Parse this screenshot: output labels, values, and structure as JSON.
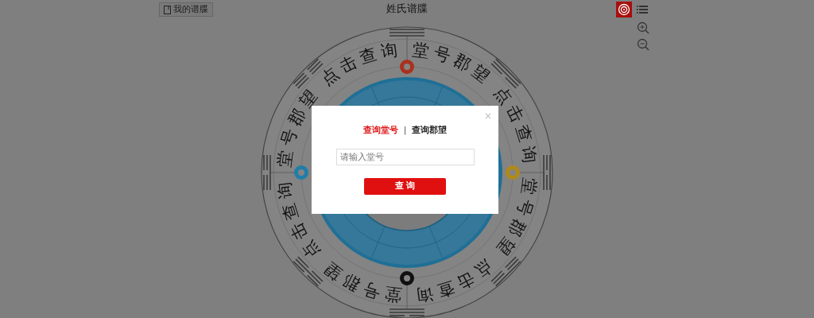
{
  "header": {
    "my_button": "我的谱牒",
    "title": "姓氏谱牒"
  },
  "toolbar": [
    {
      "kind": "target",
      "selected": true
    },
    {
      "kind": "list",
      "selected": false
    }
  ],
  "zoom": [
    {
      "kind": "zoom_in"
    },
    {
      "kind": "zoom_out"
    }
  ],
  "wheel": {
    "ring_labels": [
      "点击查询",
      "堂号郡望",
      "堂号郡望",
      "点击查询",
      "点击查询",
      "堂号郡望",
      "堂号郡望",
      "点击查询"
    ],
    "markers": [
      {
        "color": "#a8321e"
      },
      {
        "color": "#b08a18"
      },
      {
        "color": "#111111"
      },
      {
        "color": "#1f7ea8"
      }
    ]
  },
  "modal": {
    "close": "×",
    "tabs": [
      {
        "label": "查询堂号",
        "selected": true
      },
      {
        "label": "查询郡望",
        "selected": false
      }
    ],
    "separator": "|",
    "input": {
      "placeholder": "请输入堂号"
    },
    "button": "查 询"
  }
}
